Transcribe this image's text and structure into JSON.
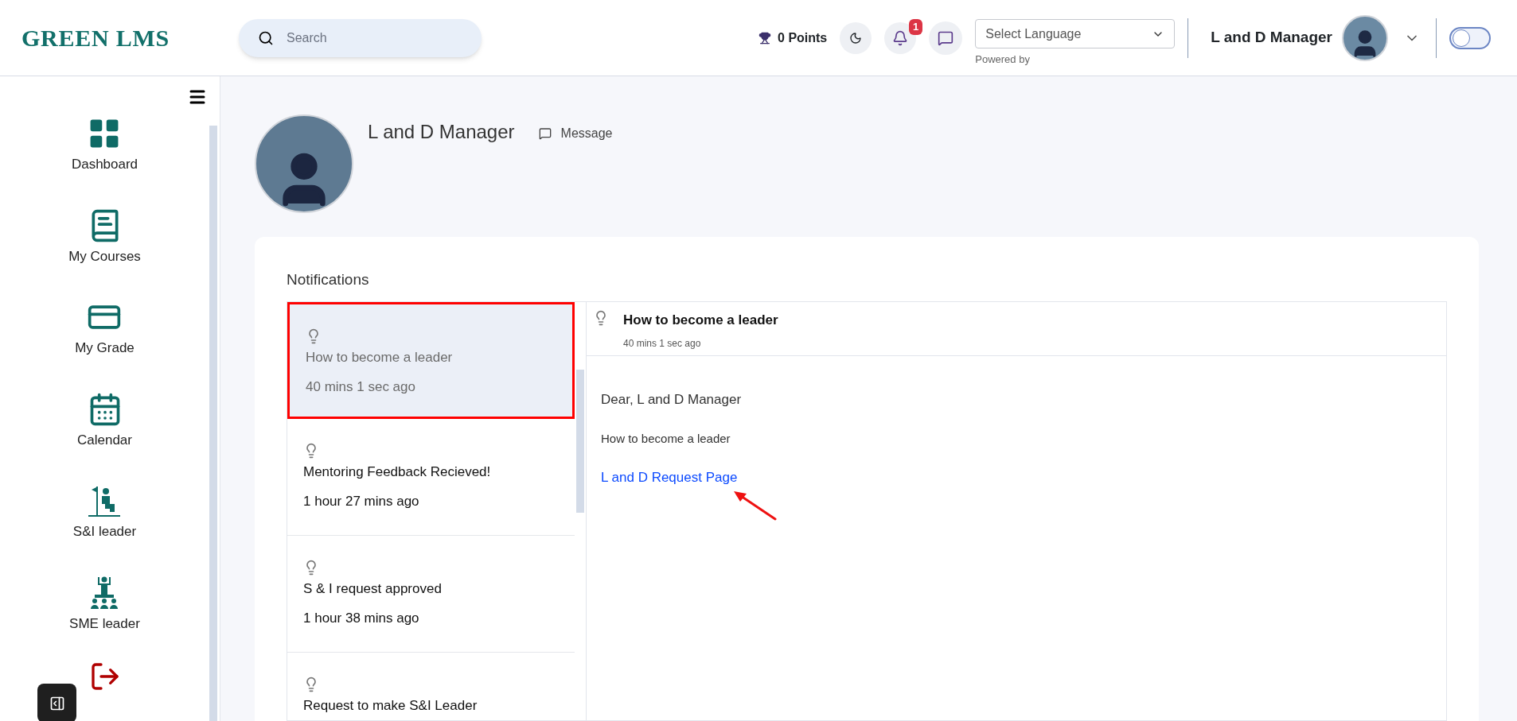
{
  "header": {
    "logo": "GREEN LMS",
    "search": {
      "placeholder": "Search"
    },
    "points": "0 Points",
    "notification_count": "1",
    "language_select": {
      "value": "Select Language"
    },
    "powered_by": "Powered by",
    "user_name": "L and D Manager",
    "theme_toggle": {
      "on": false
    }
  },
  "sidebar": {
    "items": [
      {
        "label": "Dashboard",
        "kind": "dashboard"
      },
      {
        "label": "My Courses",
        "kind": "courses"
      },
      {
        "label": "My Grade",
        "kind": "grade"
      },
      {
        "label": "Calendar",
        "kind": "calendar"
      },
      {
        "label": "S&I leader",
        "kind": "si"
      },
      {
        "label": "SME leader",
        "kind": "sme"
      }
    ]
  },
  "profile": {
    "name": "L and D Manager",
    "message_label": "Message"
  },
  "notifications": {
    "title": "Notifications",
    "items": [
      {
        "title": "How to become a leader",
        "time": "40 mins 1 sec ago",
        "selected": true
      },
      {
        "title": "Mentoring Feedback Recieved!",
        "time": "1 hour 27 mins ago",
        "selected": false
      },
      {
        "title": "S & I request approved",
        "time": "1 hour 38 mins ago",
        "selected": false
      },
      {
        "title": "Request to make S&I Leader",
        "selected": false
      }
    ],
    "detail": {
      "title": "How to become a leader",
      "time": "40 mins 1 sec ago",
      "greeting": "Dear, L and D Manager",
      "body": "How to become a leader",
      "link": "L and D Request Page"
    }
  }
}
